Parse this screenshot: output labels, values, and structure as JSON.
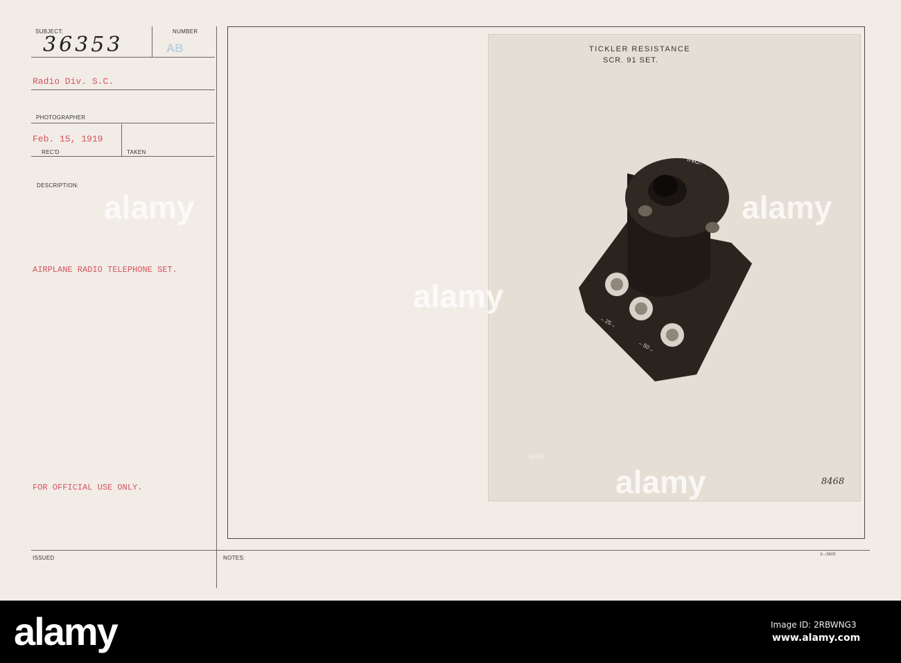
{
  "card": {
    "subject_label": "SUBJECT:",
    "subject_number": "36353",
    "number_label": "NUMBER",
    "number_stamp": "AB",
    "division": "Radio Div. S.C.",
    "photographer_label": "PHOTOGRAPHER",
    "date": "Feb. 15, 1919",
    "recd_label": "REC'D",
    "taken_label": "TAKEN",
    "description_label": "DESCRIPTION:",
    "description": "AIRPLANE RADIO TELEPHONE SET.",
    "official": "FOR OFFICIAL USE ONLY.",
    "issued_label": "ISSUED",
    "notes_label": "NOTES:",
    "form_code": "3—5605"
  },
  "photo": {
    "caption_line1": "TICKLER RESISTANCE",
    "caption_line2": "SCR. 91 SET.",
    "dial_label": "INC.",
    "terminal_a": "←25→",
    "terminal_b": "←50→",
    "neg_number": "36353",
    "handwritten": "8468"
  },
  "watermark": {
    "text": "alamy"
  },
  "banner": {
    "logo": "alamy",
    "image_id": "Image ID: 2RBWNG3",
    "url": "www.alamy.com"
  }
}
